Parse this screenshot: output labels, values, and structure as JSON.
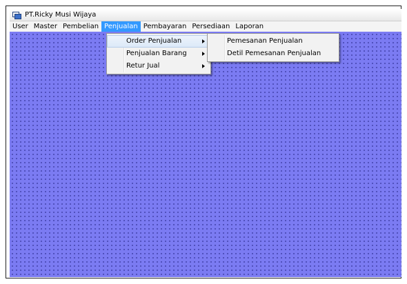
{
  "window": {
    "title": "PT.Ricky Musi Wijaya",
    "icon": "mdi-window-icon"
  },
  "menubar": {
    "items": [
      "User",
      "Master",
      "Pembelian",
      "Penjualan",
      "Pembayaran",
      "Persediaan",
      "Laporan"
    ],
    "active": "Penjualan"
  },
  "penjualan_menu": {
    "items": [
      "Order Penjualan",
      "Penjualan Barang",
      "Retur Jual"
    ],
    "highlighted": "Order Penjualan"
  },
  "order_penjualan_submenu": {
    "items": [
      "Pemesanan Penjualan",
      "Detil Pemesanan Penjualan"
    ]
  },
  "colors": {
    "mdi_background": "#7b7bf2",
    "menu_highlight": "#3399ff"
  }
}
